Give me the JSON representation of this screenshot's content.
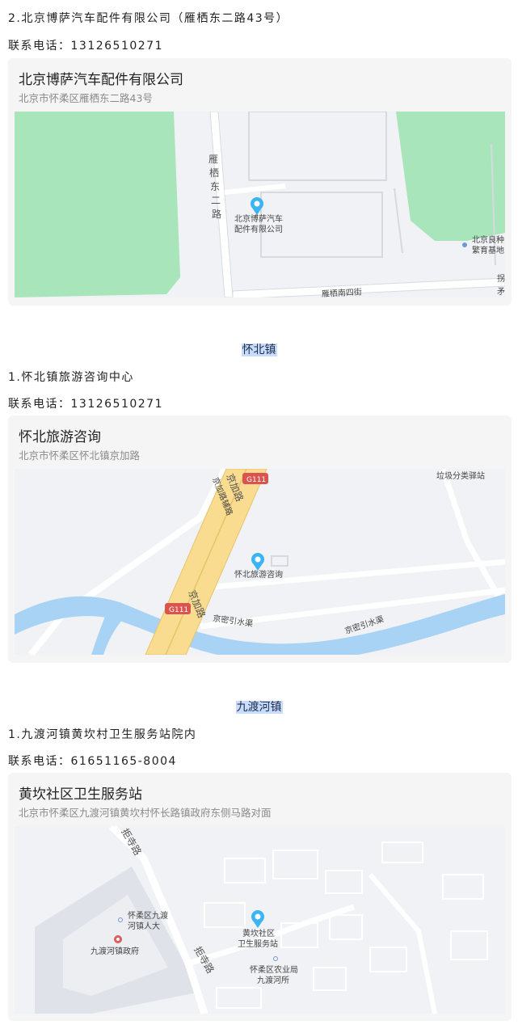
{
  "section1": {
    "item_title": "2.北京博萨汽车配件有限公司（雁栖东二路43号）",
    "phone_line": "联系电话：13126510271",
    "card": {
      "title": "北京博萨汽车配件有限公司",
      "address": "北京市怀柔区雁栖东二路43号",
      "map": {
        "poi_line1": "北京博萨汽车",
        "poi_line2": "配件有限公司",
        "road_v1": "雁",
        "road_v2": "栖",
        "road_v3": "东",
        "road_v4": "二",
        "road_v5": "路",
        "poi2_line1": "北京良种",
        "poi2_line2": "繁育基地",
        "bottom_street": "雁栖南四街",
        "edge_text1": "拐",
        "edge_text2": "矛"
      }
    }
  },
  "section2": {
    "town": "怀北镇",
    "item_title": "1.怀北镇旅游咨询中心",
    "phone_line": "联系电话：13126510271",
    "card": {
      "title": "怀北旅游咨询",
      "address": "北京市怀柔区怀北镇京加路",
      "map": {
        "poi": "怀北旅游咨询",
        "badge1": "G111",
        "badge2": "G111",
        "road_main_top": "京加路",
        "road_aux": "京加路辅路",
        "road_main_bottom": "京加路",
        "river1": "京密引水渠",
        "river2": "京密引水渠",
        "poi_top": "垃圾分类驿站"
      }
    }
  },
  "section3": {
    "town": "九渡河镇",
    "item_title": "1.九渡河镇黄坎村卫生服务站院内",
    "phone_line": "联系电话：61651165-8004",
    "card": {
      "title": "黄坎社区卫生服务站",
      "address": "北京市怀柔区九渡河镇黄坎村怀长路镇政府东侧马路对面",
      "map": {
        "poi_line1": "黄坎社区",
        "poi_line2": "卫生服务站",
        "road_top": "拒寺路",
        "road_bottom": "拒寺路",
        "gov": "九渡河镇政府",
        "npc_line1": "怀柔区九渡",
        "npc_line2": "河镇人大",
        "agri_line1": "怀柔区农业局",
        "agri_line2": "九渡河所"
      }
    }
  },
  "colors": {
    "pin": "#3ab4f2",
    "green": "#a8e5ba",
    "road": "#ffffff",
    "highway": "#f9dc8f",
    "river": "#a9d3f5",
    "badge": "#d9534f"
  }
}
